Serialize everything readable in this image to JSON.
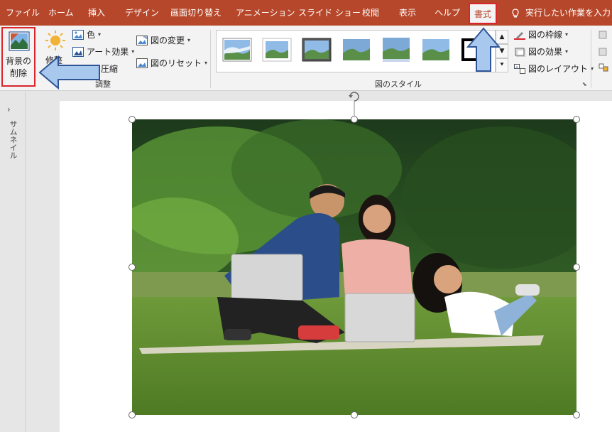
{
  "tabs": [
    {
      "label": "ファイル"
    },
    {
      "label": "ホーム"
    },
    {
      "label": "挿入"
    },
    {
      "label": "デザイン"
    },
    {
      "label": "画面切り替え"
    },
    {
      "label": "アニメーション"
    },
    {
      "label": "スライド ショー"
    },
    {
      "label": "校閲"
    },
    {
      "label": "表示"
    },
    {
      "label": "ヘルプ"
    },
    {
      "label": "書式"
    }
  ],
  "active_tab": "書式",
  "tell_me": "実行したい作業を入力",
  "ribbon": {
    "remove_background": "背景の\n削除",
    "remove_background_line1": "背景の",
    "remove_background_line2": "削除",
    "corrections": "修整",
    "color": "色",
    "artistic_effects": "アート効果",
    "compress": "圧縮",
    "change_picture": "図の変更",
    "reset_picture": "図のリセット",
    "adjust_group": "調整",
    "styles_group": "図のスタイル",
    "picture_border": "図の枠線",
    "picture_effects": "図の効果",
    "picture_layout": "図のレイアウト"
  },
  "thumbnail_pane": {
    "label": "サムネイル"
  },
  "colors": {
    "tab_bar": "#b7472a",
    "highlight": "#d8262c",
    "arrow_fill": "#a9c8ee",
    "arrow_stroke": "#2f5597"
  },
  "icons": [
    "remove-background-icon",
    "corrections-icon",
    "color-icon",
    "artistic-effects-icon",
    "compress-icon",
    "change-picture-icon",
    "reset-picture-icon",
    "picture-border-icon",
    "picture-effects-icon",
    "picture-layout-icon",
    "lightbulb-icon",
    "rotate-handle-icon"
  ]
}
